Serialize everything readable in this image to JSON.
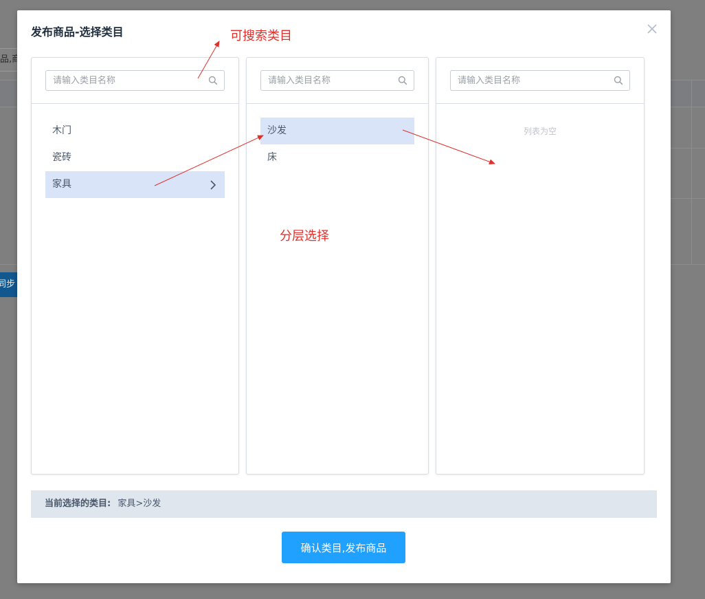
{
  "background": {
    "search_fragment": "品,商品",
    "sync_button": "同步"
  },
  "modal": {
    "title": "发布商品-选择类目",
    "close_icon": "close-icon"
  },
  "columns": [
    {
      "search_placeholder": "请输入类目名称",
      "items": [
        "木门",
        "瓷砖",
        "家具"
      ],
      "selected_index": 2
    },
    {
      "search_placeholder": "请输入类目名称",
      "items": [
        "沙发",
        "床"
      ],
      "selected_index": 0
    },
    {
      "search_placeholder": "请输入类目名称",
      "items": [],
      "empty_text": "列表为空"
    }
  ],
  "current_selection": {
    "label": "当前选择的类目:",
    "value": "家具>沙发"
  },
  "confirm_button": "确认类目,发布商品",
  "annotations": {
    "searchable": "可搜索类目",
    "hierarchical": "分层选择"
  },
  "colors": {
    "primary": "#20a0ff",
    "selected_bg": "#d9e4f8",
    "annotation": "#e0302b",
    "overlay": "#7f7f7f"
  }
}
